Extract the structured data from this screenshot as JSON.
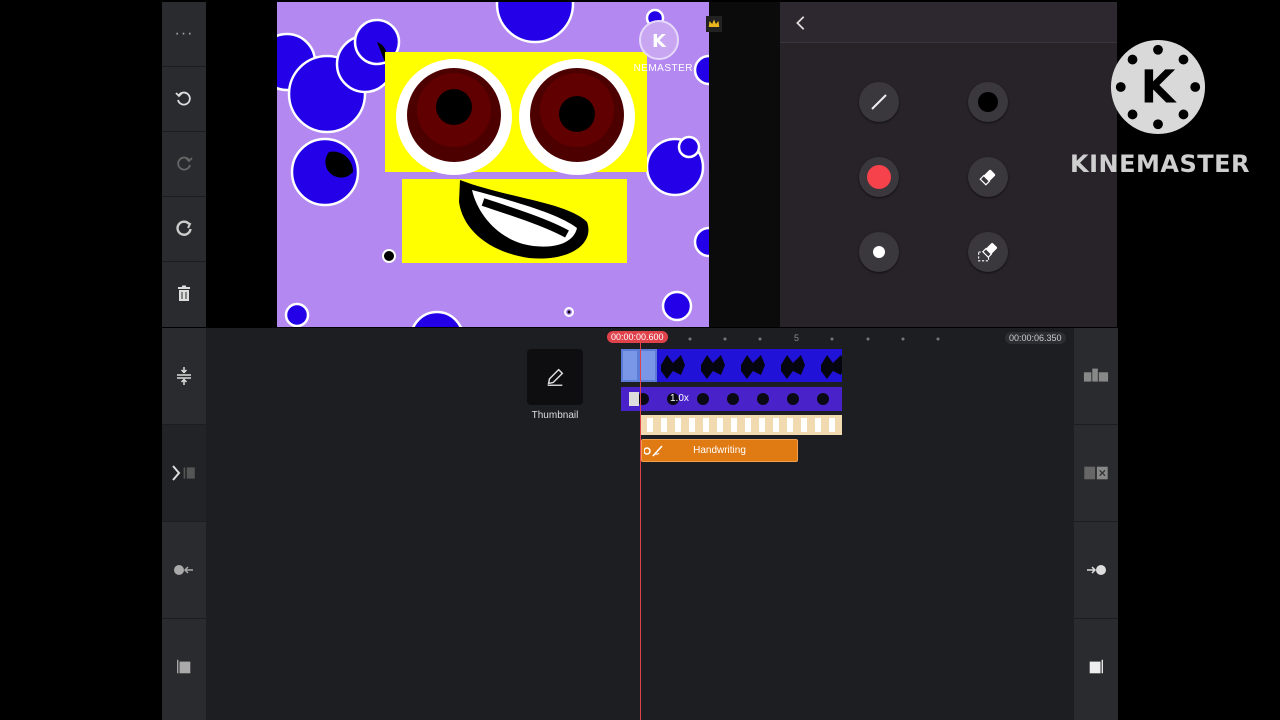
{
  "left_toolbar": {
    "items": [
      {
        "name": "more-icon",
        "glyph": "···"
      },
      {
        "name": "undo-icon"
      },
      {
        "name": "redo-icon"
      },
      {
        "name": "reset-icon"
      },
      {
        "name": "delete-icon"
      }
    ]
  },
  "preview": {
    "watermark_text": "KINEMASTER",
    "background_color": "#b388f0",
    "accent_blue": "#2300e8",
    "face_yellow": "#ffff00"
  },
  "right_panel": {
    "back_icon": "chevron-left-icon",
    "tools": [
      {
        "name": "line-tool",
        "icon": "line-icon"
      },
      {
        "name": "color-black",
        "icon": "black-dot-icon"
      },
      {
        "name": "color-red",
        "icon": "red-dot-icon",
        "color": "#f5424b"
      },
      {
        "name": "eraser-tool",
        "icon": "eraser-icon"
      },
      {
        "name": "brush-size",
        "icon": "white-dot-icon"
      },
      {
        "name": "area-eraser-tool",
        "icon": "area-eraser-icon"
      }
    ]
  },
  "brand": {
    "logo_text": "KINEMASTER"
  },
  "timeline": {
    "current_time": "00:00:00.600",
    "end_time": "00:00:06.350",
    "ruler_marker": "5",
    "thumbnail_label": "Thumbnail",
    "speed_label": "1.0x",
    "handwriting_label": "Handwriting",
    "accent_red": "#e0424c",
    "handwriting_color": "#e07a12"
  }
}
